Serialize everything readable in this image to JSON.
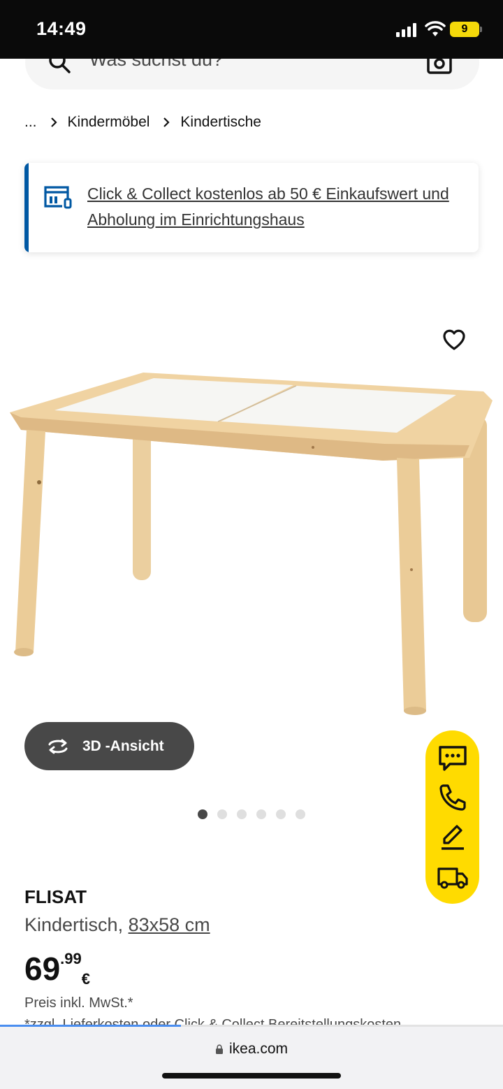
{
  "status_bar": {
    "time": "14:49",
    "battery_level": "9"
  },
  "search": {
    "placeholder": "Was suchst du?"
  },
  "breadcrumb": {
    "ellipsis": "...",
    "items": [
      "Kindermöbel",
      "Kindertische"
    ]
  },
  "banner": {
    "text": "Click & Collect kostenlos ab 50 € Einkaufswert und Abholung im Einrichtungshaus",
    "accent_color": "#0058a3"
  },
  "gallery": {
    "button_3d_label": "3D -Ansicht",
    "dot_count": 6,
    "active_index": 0
  },
  "fab": {
    "color": "#ffdb00",
    "icons": [
      "chat-icon",
      "phone-icon",
      "edit-icon",
      "truck-icon"
    ]
  },
  "product": {
    "name": "FLISAT",
    "description": "Kindertisch, ",
    "dimensions": "83x58 cm",
    "price_integer": "69",
    "price_decimal": ".99",
    "currency": "€",
    "vat_note": "Preis inkl. MwSt.*",
    "extra_note": "*zzgl. Lieferkosten oder Click & Collect Bereitstellungskosten"
  },
  "browser": {
    "url": "ikea.com",
    "load_progress": 0.36
  }
}
